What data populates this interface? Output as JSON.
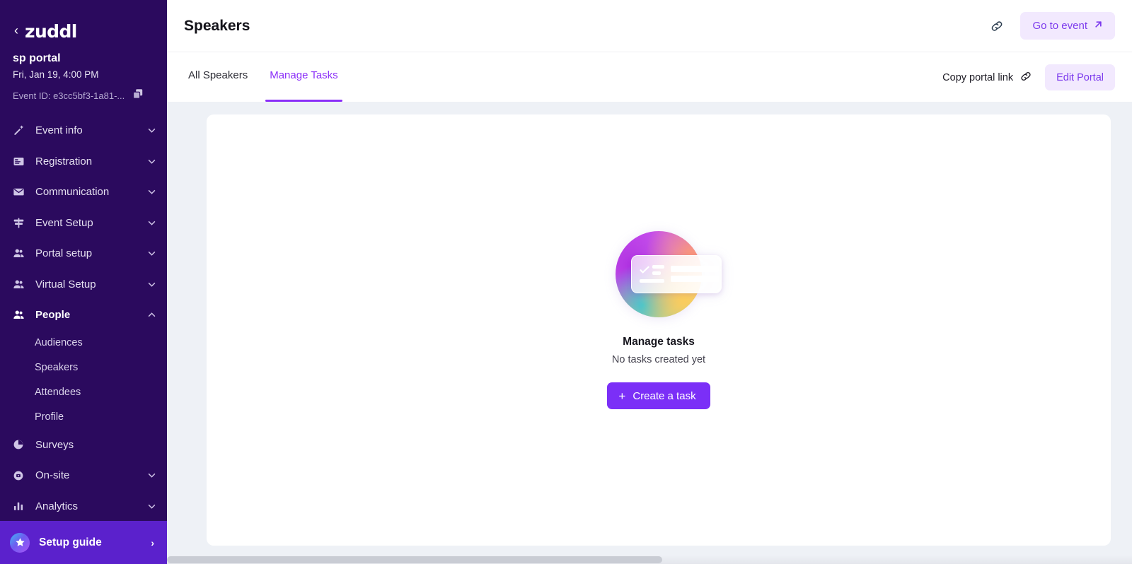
{
  "sidebar": {
    "brand": {
      "back_icon": "chevron-left-icon",
      "name": "zuddl"
    },
    "event": {
      "title": "sp portal",
      "date": "Fri, Jan 19, 4:00 PM",
      "event_id": "Event ID: e3cc5bf3-1a81-...",
      "copy_icon": "copy-icon"
    },
    "nav": [
      {
        "label": "Event info",
        "icon": "magic-wand-icon",
        "expandable": true,
        "expanded": false,
        "active": false
      },
      {
        "label": "Registration",
        "icon": "form-card-icon",
        "expandable": true,
        "expanded": false,
        "active": false
      },
      {
        "label": "Communication",
        "icon": "envelope-icon",
        "expandable": true,
        "expanded": false,
        "active": false
      },
      {
        "label": "Event Setup",
        "icon": "signpost-icon",
        "expandable": true,
        "expanded": false,
        "active": false
      },
      {
        "label": "Portal setup",
        "icon": "people-icon",
        "expandable": true,
        "expanded": false,
        "active": false
      },
      {
        "label": "Virtual Setup",
        "icon": "people-icon",
        "expandable": true,
        "expanded": false,
        "active": false
      },
      {
        "label": "People",
        "icon": "people-icon",
        "expandable": true,
        "expanded": true,
        "active": true
      },
      {
        "label": "Surveys",
        "icon": "pie-chart-icon",
        "expandable": false,
        "expanded": false,
        "active": false
      },
      {
        "label": "On-site",
        "icon": "badge-scan-icon",
        "expandable": true,
        "expanded": false,
        "active": false
      },
      {
        "label": "Analytics",
        "icon": "bar-chart-icon",
        "expandable": true,
        "expanded": false,
        "active": false
      }
    ],
    "people_subitems": [
      {
        "label": "Audiences"
      },
      {
        "label": "Speakers"
      },
      {
        "label": "Attendees"
      },
      {
        "label": "Profile"
      }
    ],
    "setup_guide": {
      "label": "Setup guide",
      "icon": "star-icon",
      "arrow_icon": "chevron-right-icon"
    }
  },
  "topbar": {
    "page_title": "Speakers",
    "link_icon": "link-icon",
    "go_to_event": {
      "label": "Go to event",
      "icon": "arrow-up-right-icon"
    }
  },
  "tabbar": {
    "tabs": [
      {
        "label": "All Speakers",
        "active": false
      },
      {
        "label": "Manage Tasks",
        "active": true
      }
    ],
    "copy_portal_link": {
      "label": "Copy portal link",
      "icon": "link-icon"
    },
    "edit_portal": {
      "label": "Edit Portal"
    }
  },
  "empty_state": {
    "illustration": "tasks-card-illustration",
    "title": "Manage tasks",
    "subtitle": "No tasks created yet",
    "create_button": {
      "label": "Create a task",
      "icon": "plus-icon"
    }
  },
  "colors": {
    "sidebar_bg": "#2b0a5e",
    "accent_purple": "#8b2ff8",
    "primary_button": "#7b2ff7",
    "soft_purple_bg": "#f2e9fe",
    "page_bg": "#eef1f6",
    "setup_guide_bg": "#5b21cc"
  }
}
